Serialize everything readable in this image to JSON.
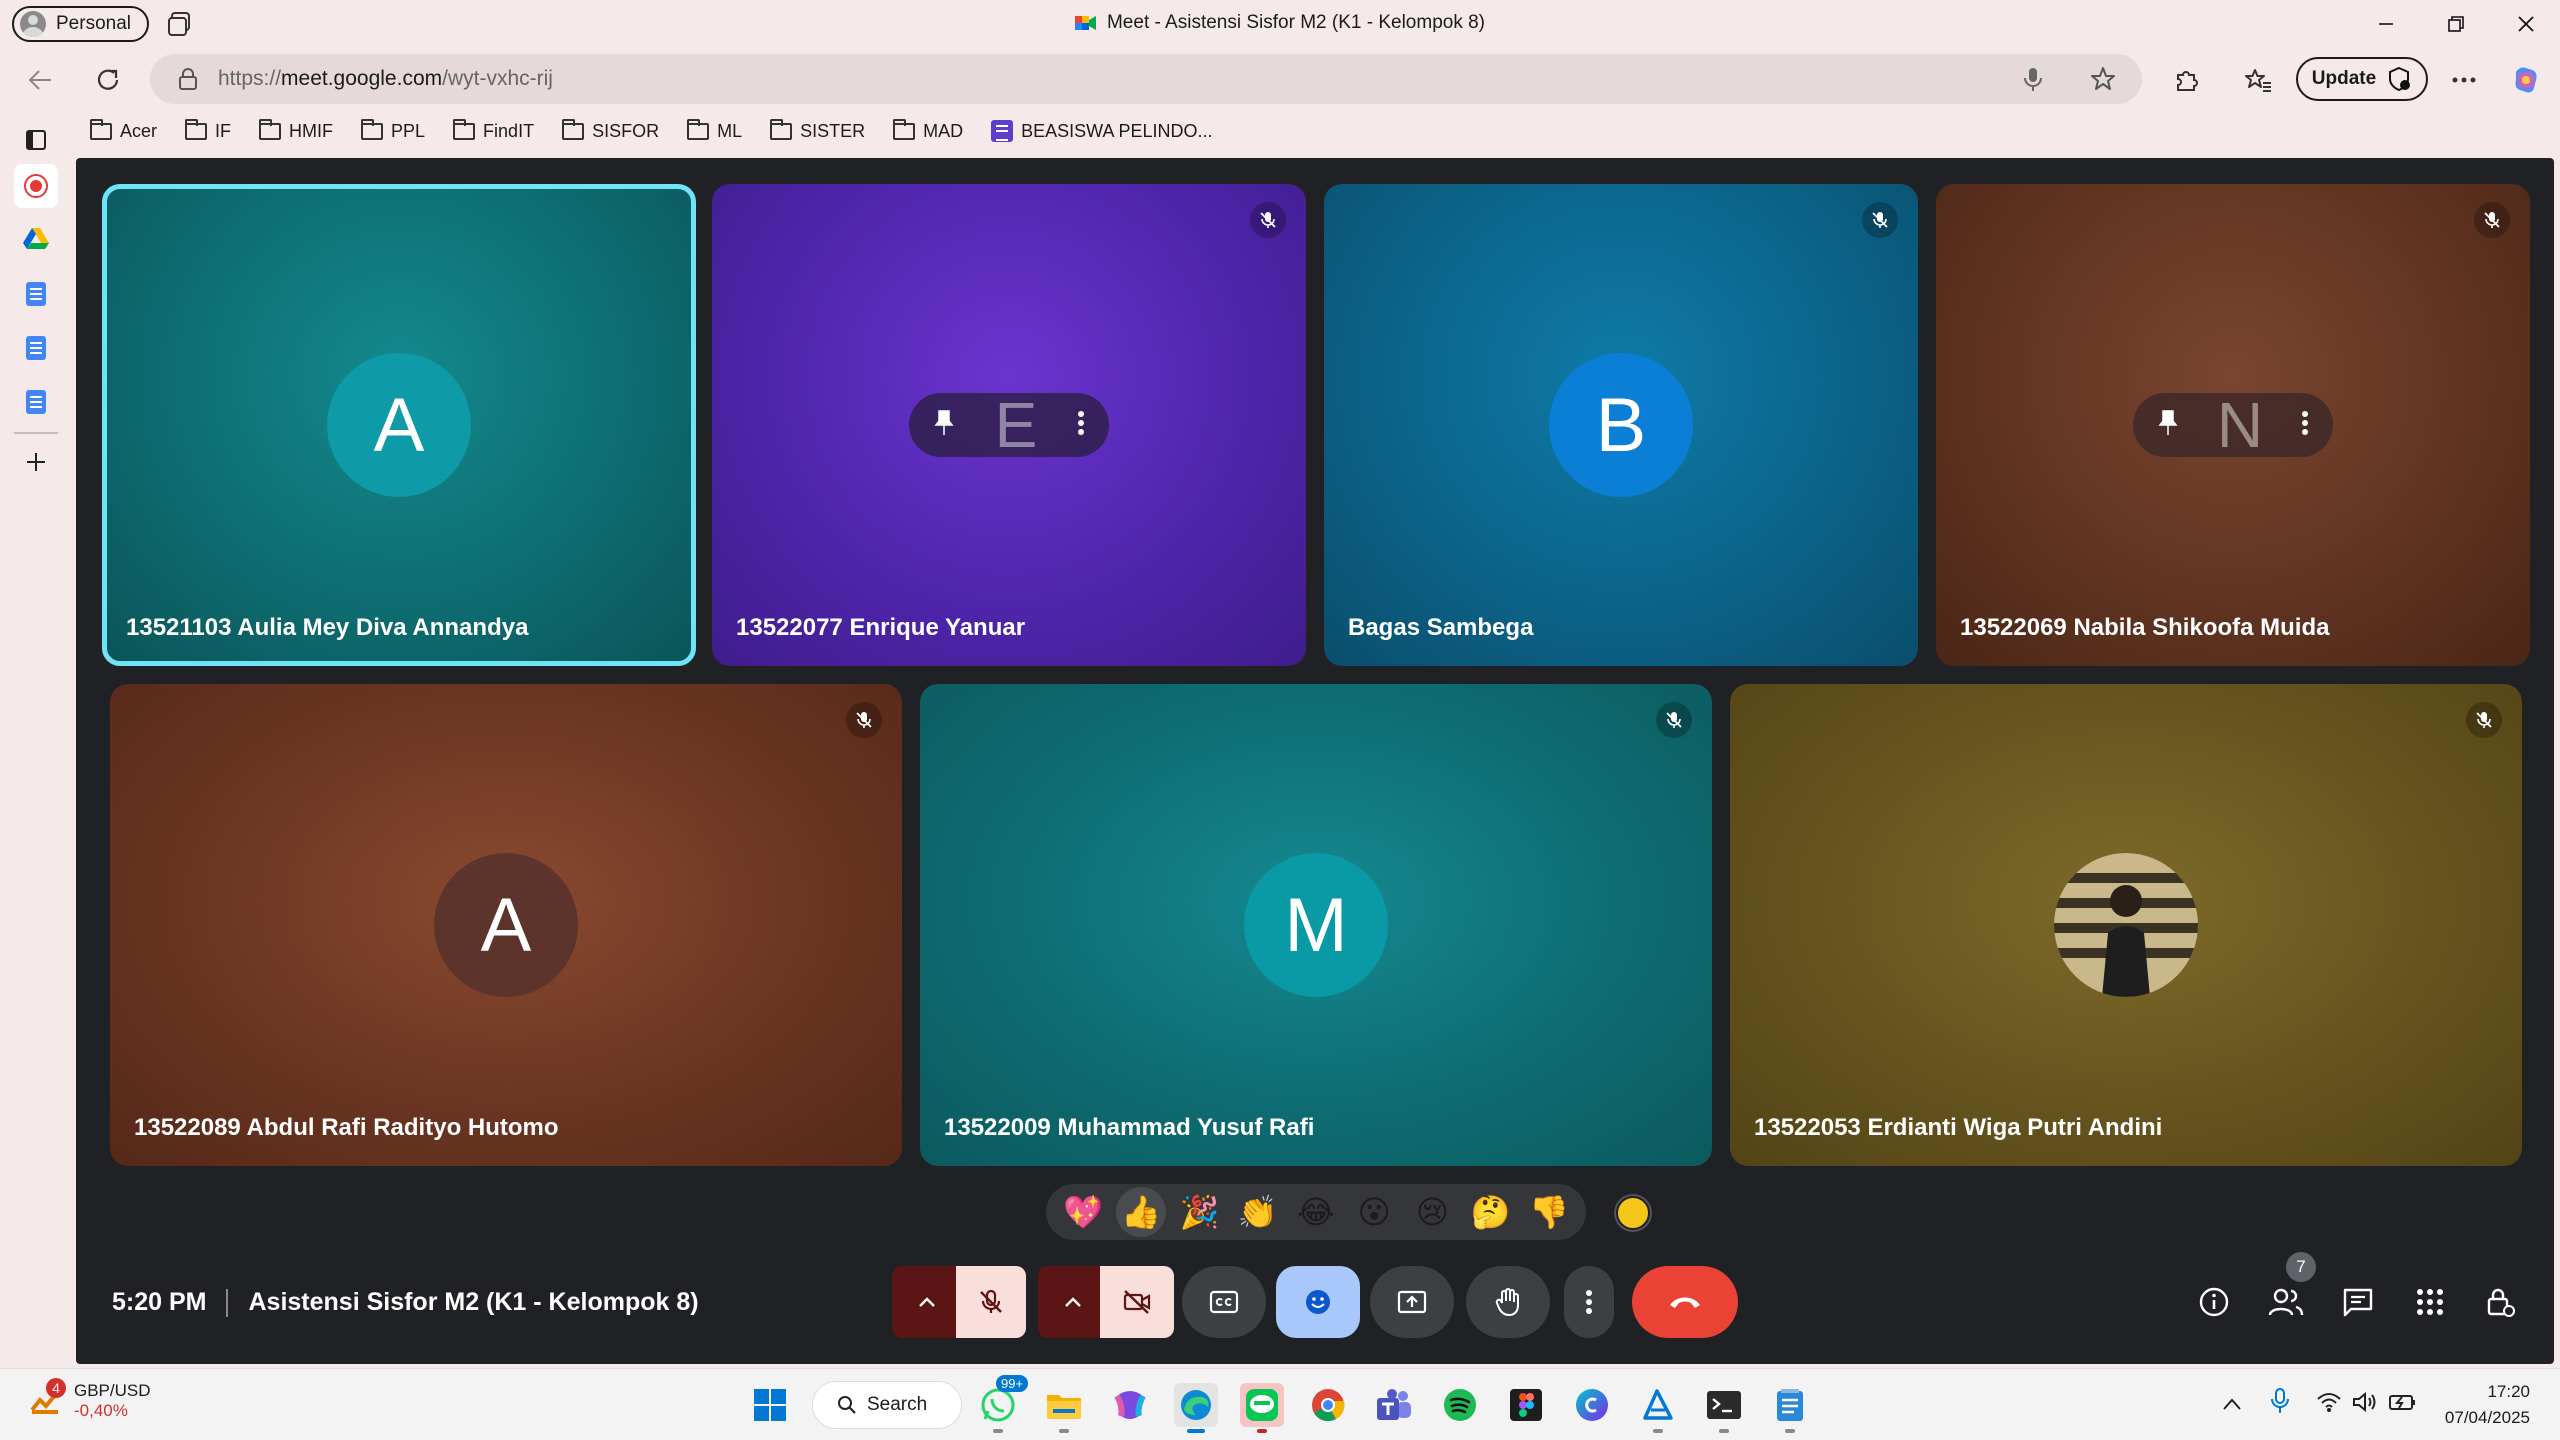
{
  "browser": {
    "profile_label": "Personal",
    "window_title": "Meet - Asistensi Sisfor M2 (K1 - Kelompok 8)",
    "url_prefix": "https://",
    "url_host": "meet.google.com",
    "url_path": "/wyt-vxhc-rij",
    "update_label": "Update"
  },
  "bookmarks": [
    {
      "label": "Acer",
      "icon": "folder-icon"
    },
    {
      "label": "IF",
      "icon": "folder-icon"
    },
    {
      "label": "HMIF",
      "icon": "folder-icon"
    },
    {
      "label": "PPL",
      "icon": "folder-icon"
    },
    {
      "label": "FindIT",
      "icon": "folder-icon"
    },
    {
      "label": "SISFOR",
      "icon": "folder-icon"
    },
    {
      "label": "ML",
      "icon": "folder-icon"
    },
    {
      "label": "SISTER",
      "icon": "folder-icon"
    },
    {
      "label": "MAD",
      "icon": "folder-icon"
    },
    {
      "label": "BEASISWA PELINDO...",
      "icon": "sheets-icon"
    }
  ],
  "participants": [
    {
      "name": "13521103 Aulia Mey Diva Annandya",
      "initial": "A",
      "avatar_color": "#0e9aa7",
      "bg": "#0f6e73",
      "muted": false,
      "selected": true
    },
    {
      "name": "13522077 Enrique Yanuar",
      "initial": "E",
      "avatar_color": "#6a3fc4",
      "bg": "#5a2ec4",
      "muted": true,
      "hover_menu": true
    },
    {
      "name": "Bagas Sambega",
      "initial": "B",
      "avatar_color": "#0b7fd6",
      "bg": "#0b6a99",
      "muted": true
    },
    {
      "name": "13522069 Nabila Shikoofa Muida",
      "initial": "N",
      "avatar_color": "#7a4030",
      "bg": "#6e3a22",
      "muted": true,
      "hover_menu": true
    },
    {
      "name": "13522089 Abdul Rafi Radityo Hutomo",
      "initial": "A",
      "avatar_color": "#6b3b30",
      "bg": "#7a3a26",
      "muted": true
    },
    {
      "name": "13522009 Muhammad Yusuf Rafi",
      "initial": "M",
      "avatar_color": "#0a8e9c",
      "bg": "#0e6f76",
      "muted": true
    },
    {
      "name": "13522053 Erdianti Wiga Putri Andini",
      "initial": "",
      "avatar_color": "#3a3a2a",
      "bg": "#6e5a1e",
      "muted": true,
      "photo": true
    }
  ],
  "reactions": [
    "💖",
    "👍",
    "🎉",
    "👏",
    "😂",
    "😮",
    "😢",
    "🤔",
    "👎"
  ],
  "meeting": {
    "time": "5:20 PM",
    "title": "Asistensi Sisfor M2 (K1 - Kelompok 8)",
    "participant_count": "7"
  },
  "colors": {
    "meet_bg": "#202124",
    "leave_red": "#ea4335",
    "mic_off_bg": "#f9dedc",
    "emoji_active": "#a8c7fa",
    "selected_ring": "#6ee4f5"
  },
  "taskbar": {
    "ticker_name": "GBP/USD",
    "ticker_change": "-0,40%",
    "ticker_badge": "4",
    "search_label": "Search",
    "whatsapp_badge": "99+",
    "time": "17:20",
    "date": "07/04/2025"
  }
}
